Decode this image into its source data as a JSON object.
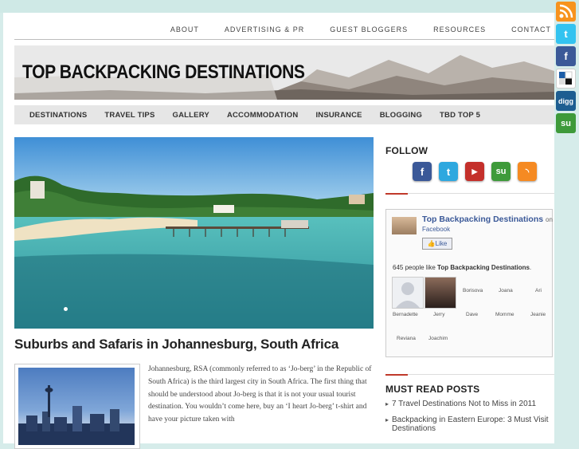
{
  "top_nav": [
    "ABOUT",
    "ADVERTISING & PR",
    "GUEST BLOGGERS",
    "RESOURCES",
    "CONTACT"
  ],
  "site_title": "TOP BACKPACKING DESTINATIONS",
  "main_nav": [
    "DESTINATIONS",
    "TRAVEL TIPS",
    "GALLERY",
    "ACCOMMODATION",
    "INSURANCE",
    "BLOGGING",
    "TBD TOP 5"
  ],
  "post": {
    "title": "Suburbs and Safaris in Johannesburg, South Africa",
    "excerpt": "Johannesburg, RSA (commonly referred to as ‘Jo-berg’ in the Republic of South Africa) is the third largest city in South Africa. The first thing that should be understood about Jo-berg is that it is not your usual tourist destination. You wouldn’t come here, buy an ‘I heart Jo-berg’ t-shirt and have your picture taken with"
  },
  "sidebar": {
    "follow_heading": "FOLLOW",
    "follow_icons": [
      "facebook-icon",
      "twitter-icon",
      "youtube-icon",
      "stumbleupon-icon",
      "rss-icon"
    ],
    "facebook": {
      "page_name": "Top Backpacking Destinations",
      "on_text": "on",
      "sub_text": "Facebook",
      "like_label": "Like",
      "count_prefix": "645 people like ",
      "count_page": "Top Backpacking Destinations",
      "count_suffix": ".",
      "fans": [
        "Borisova",
        "Joana",
        "Ari",
        "Bernadette",
        "Jerry",
        "Dave",
        "Momme",
        "Jeanie",
        "Reviana",
        "Joachim"
      ]
    },
    "must_read_heading": "MUST READ POSTS",
    "must_read": [
      "7 Travel Destinations Not to Miss in 2011",
      "Backpacking in Eastern Europe: 3 Must Visit Destinations"
    ]
  },
  "social_bar": [
    {
      "name": "rss-icon",
      "glyph": "",
      "color": "#f7931e"
    },
    {
      "name": "twitter-icon",
      "glyph": "t",
      "color": "#33c3f0"
    },
    {
      "name": "facebook-icon",
      "glyph": "f",
      "color": "#3b5998"
    },
    {
      "name": "delicious-icon",
      "glyph": "",
      "color": "#ffffff"
    },
    {
      "name": "digg-icon",
      "glyph": "digg",
      "color": "#1d5e91"
    },
    {
      "name": "stumbleupon-icon",
      "glyph": "su",
      "color": "#3e9a3a"
    }
  ]
}
